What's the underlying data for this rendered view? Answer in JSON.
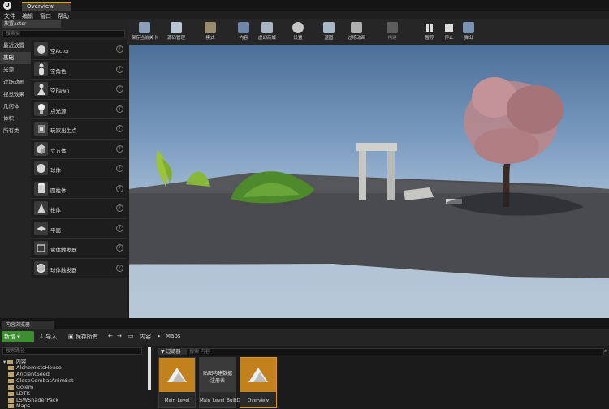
{
  "window": {
    "tab_title": "Overview",
    "logo": "U"
  },
  "menu": [
    "文件",
    "编辑",
    "窗口",
    "帮助"
  ],
  "place_panel": {
    "tab_title": "放置actor",
    "search_placeholder": "搜索类",
    "categories": [
      "最近放置",
      "基础",
      "光源",
      "过场动画",
      "视觉效果",
      "几何体",
      "体积",
      "所有类"
    ],
    "active_category": "基础",
    "actors": [
      "空Actor",
      "空角色",
      "空Pawn",
      "点光源",
      "玩家出生点",
      "立方体",
      "球体",
      "圆柱体",
      "椎体",
      "平面",
      "盒体触发器",
      "球体触发器"
    ],
    "help_glyph": "?"
  },
  "toolbar": {
    "buttons": [
      {
        "label": "保存当前关卡",
        "icon": "save-icon"
      },
      {
        "label": "源码管理",
        "icon": "source-control-icon"
      },
      {
        "label": "模式",
        "icon": "modes-icon"
      },
      {
        "label": "内容",
        "icon": "content-icon"
      },
      {
        "label": "虚幻商城",
        "icon": "marketplace-icon"
      },
      {
        "label": "设置",
        "icon": "settings-icon"
      },
      {
        "label": "蓝图",
        "icon": "blueprint-icon"
      },
      {
        "label": "过场动画",
        "icon": "cinematics-icon"
      },
      {
        "label": "构建",
        "icon": "build-icon"
      },
      {
        "label": "暂停",
        "icon": "pause-icon"
      },
      {
        "label": "停止",
        "icon": "stop-icon"
      },
      {
        "label": "弹出",
        "icon": "eject-icon"
      }
    ]
  },
  "content_browser": {
    "tab_title": "内容浏览器",
    "new_label": "新增",
    "import_label": "导入",
    "save_all_label": "保存所有",
    "breadcrumb": [
      "内容",
      "Maps"
    ],
    "folder_search_placeholder": "搜索路径",
    "tree_root": "内容",
    "folders": [
      "AlchemistsHouse",
      "AncientSeed",
      "CloseCombatAnimSet",
      "Golem",
      "LDTK",
      "LSWShaderPack",
      "Maps"
    ],
    "filter_label": "过滤器",
    "asset_search_placeholder": "搜索 内容",
    "assets": [
      "Main_Level",
      "Main_Level_BuiltData",
      "Overview"
    ],
    "builtdata_thumb_text": "贴图构建数据\n注册表"
  },
  "colors": {
    "accent": "#e6a300",
    "new_button": "#3c8f2f",
    "asset_thumb": "#c2811d"
  }
}
